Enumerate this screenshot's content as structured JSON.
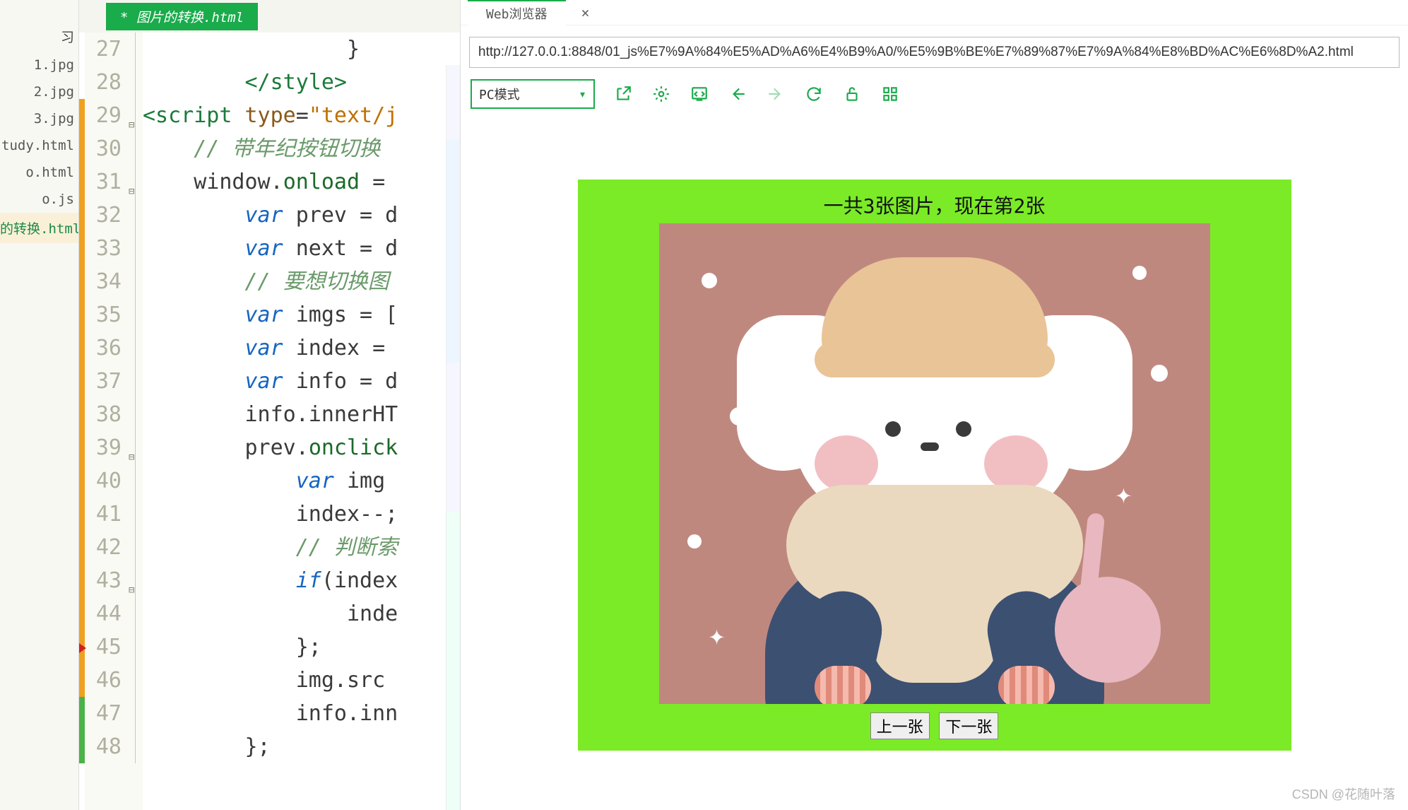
{
  "sidebar": {
    "section": "习",
    "items": [
      {
        "label": "1.jpg"
      },
      {
        "label": "2.jpg"
      },
      {
        "label": "3.jpg"
      },
      {
        "label": "tudy.html"
      },
      {
        "label": "o.html"
      },
      {
        "label": "o.js"
      },
      {
        "label": "的转换.html"
      }
    ],
    "active_index": 6
  },
  "editor": {
    "tab_title": "* 图片的转换.html",
    "lines": [
      {
        "n": 27,
        "html": "                }",
        "mod": null,
        "fold": "bar"
      },
      {
        "n": 28,
        "html": "        <span class='t-tag'>&lt;/style&gt;</span>",
        "mod": null,
        "fold": "bar"
      },
      {
        "n": 29,
        "html": "<span class='t-tag'>&lt;script</span> <span class='t-attr'>type</span>=<span class='t-str'>\"text/j</span>",
        "mod": "orange",
        "fold": "box"
      },
      {
        "n": 30,
        "html": "    <span class='t-com'>// 带年纪按钮切换</span>",
        "mod": "orange",
        "fold": "bar"
      },
      {
        "n": 31,
        "html": "    window.<span class='t-fn'>onload</span> = ",
        "mod": "orange",
        "fold": "box"
      },
      {
        "n": 32,
        "html": "        <span class='t-kw'>var</span> prev = d",
        "mod": "orange",
        "fold": "bar"
      },
      {
        "n": 33,
        "html": "        <span class='t-kw'>var</span> next = d",
        "mod": "orange",
        "fold": "bar"
      },
      {
        "n": 34,
        "html": "        <span class='t-com'>// 要想切换图</span>",
        "mod": "orange",
        "fold": "bar"
      },
      {
        "n": 35,
        "html": "        <span class='t-kw'>var</span> imgs = [",
        "mod": "orange",
        "fold": "bar"
      },
      {
        "n": 36,
        "html": "        <span class='t-kw'>var</span> index = ",
        "mod": "orange",
        "fold": "bar"
      },
      {
        "n": 37,
        "html": "        <span class='t-kw'>var</span> info = d",
        "mod": "orange",
        "fold": "bar"
      },
      {
        "n": 38,
        "html": "        info.innerHT",
        "mod": "orange",
        "fold": "bar"
      },
      {
        "n": 39,
        "html": "        prev.<span class='t-fn'>onclick</span>",
        "mod": "orange",
        "fold": "box"
      },
      {
        "n": 40,
        "html": "            <span class='t-kw'>var</span> img ",
        "mod": "orange",
        "fold": "bar"
      },
      {
        "n": 41,
        "html": "            index--;",
        "mod": "orange",
        "fold": "bar"
      },
      {
        "n": 42,
        "html": "            <span class='t-com'>// 判断索</span>",
        "mod": "orange",
        "fold": "bar"
      },
      {
        "n": 43,
        "html": "            <span class='t-kw'>if</span>(index",
        "mod": "orange",
        "fold": "box"
      },
      {
        "n": 44,
        "html": "                inde",
        "mod": "orange",
        "fold": "bar"
      },
      {
        "n": 45,
        "html": "            };",
        "mod": "orange",
        "fold": "bar"
      },
      {
        "n": 46,
        "html": "            img.src ",
        "mod": "orange",
        "fold": "bar"
      },
      {
        "n": 47,
        "html": "            info.inn",
        "mod": "green",
        "fold": "bar"
      },
      {
        "n": 48,
        "html": "        };",
        "mod": "green",
        "fold": "bar"
      }
    ],
    "caret_line_index": 18
  },
  "browser": {
    "tab_label": "Web浏览器",
    "close_glyph": "×",
    "url": "http://127.0.0.1:8848/01_js%E7%9A%84%E5%AD%A6%E4%B9%A0/%E5%9B%BE%E7%89%87%E7%9A%84%E8%BD%AC%E6%8D%A2.html",
    "mode_label": "PC模式",
    "toolbar_icons": [
      "external",
      "settings",
      "devtools",
      "back",
      "forward",
      "reload",
      "lock",
      "grid"
    ]
  },
  "preview": {
    "caption": "一共3张图片，现在第2张",
    "prev_btn": "上一张",
    "next_btn": "下一张"
  },
  "watermark": "CSDN @花随叶落"
}
